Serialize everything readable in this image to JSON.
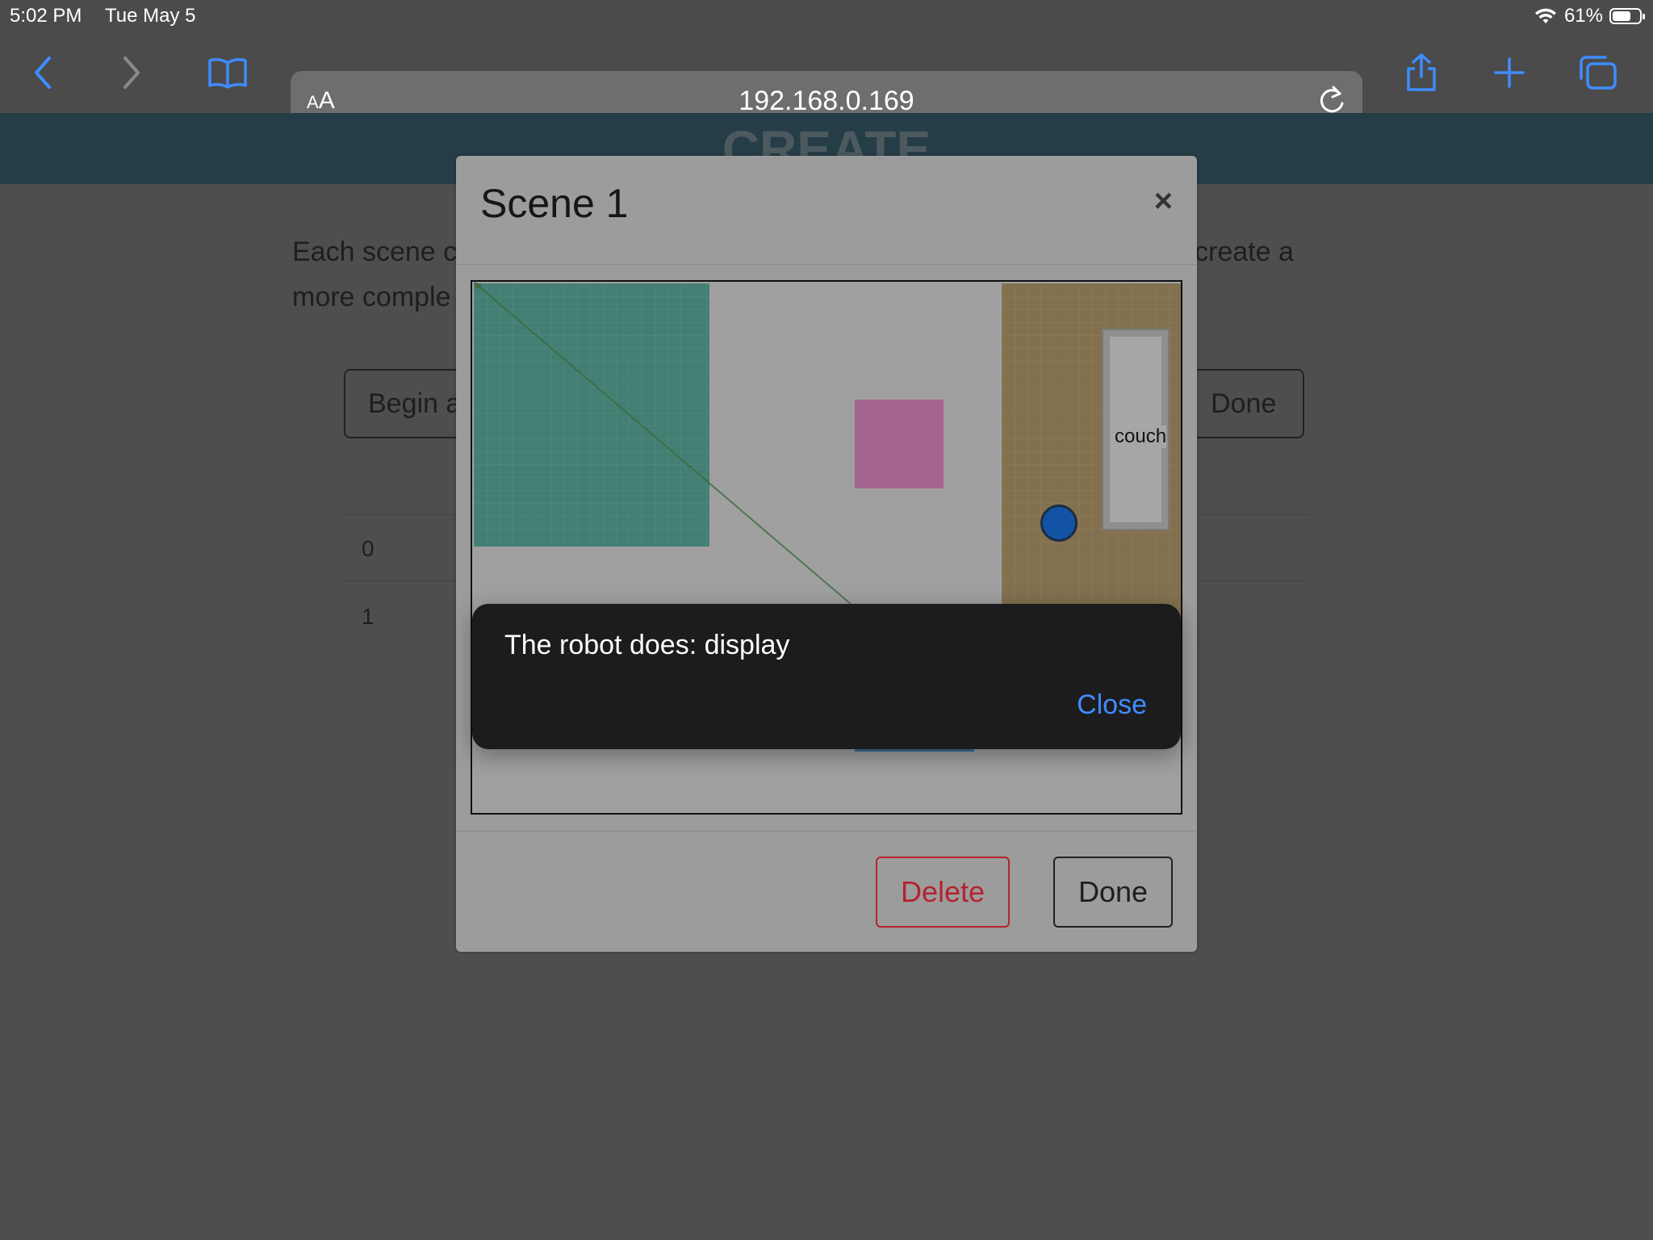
{
  "status_bar": {
    "time": "5:02 PM",
    "date": "Tue May 5",
    "battery": "61%"
  },
  "browser": {
    "text_size_label_small": "A",
    "text_size_label_large": "A",
    "url": "192.168.0.169"
  },
  "page": {
    "banner_title": "CREATE",
    "intro_line1": "Each scene c",
    "intro_line1_tail": "create a",
    "intro_line2": "more comple",
    "begin_button": "Begin a",
    "done_button": "Done",
    "rows": [
      "0",
      "1"
    ]
  },
  "modal": {
    "title": "Scene 1",
    "close_symbol": "×",
    "couch_label": "couch",
    "delete_button": "Delete",
    "done_button": "Done"
  },
  "toast": {
    "message": "The robot does: display",
    "close_label": "Close"
  },
  "colors": {
    "accent_blue": "#3f8cff",
    "danger": "#b4232f",
    "banner": "#253d47"
  }
}
